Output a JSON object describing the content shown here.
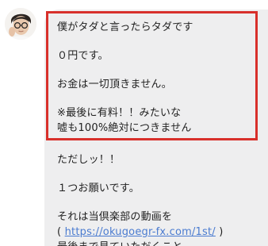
{
  "message": {
    "block1": {
      "line1": "僕がタダと言ったらタダです",
      "line2": "０円です。",
      "line3": "お金は一切頂きません。",
      "line4": "※最後に有料！！みたいな",
      "line5": "嘘も100%絶対につきません"
    },
    "block2": {
      "line1": "ただしッ！！",
      "line2": "１つお願いです。",
      "line3": "それは当倶楽部の動画を",
      "line4_prefix": "( ",
      "link_text": "https://okugoegr-fx.com/1st/",
      "line4_suffix": " )",
      "line5": "最後まで見ていただくこと。"
    }
  },
  "colors": {
    "highlight_border": "#d8302b",
    "bubble_bg": "#eeeeef",
    "link": "#4a7bd0"
  },
  "icons": {
    "avatar": "person-with-glasses-avatar"
  }
}
